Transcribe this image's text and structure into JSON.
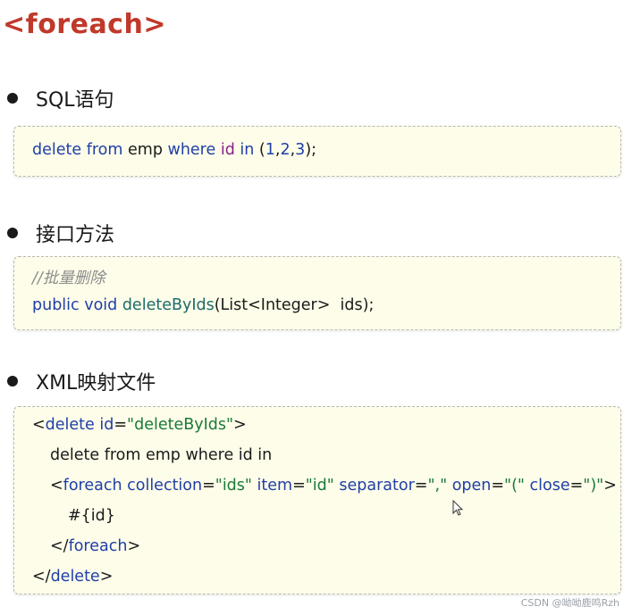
{
  "title": "<foreach>",
  "sections": [
    {
      "label": "SQL语句"
    },
    {
      "label": "接口方法"
    },
    {
      "label": "XML映射文件"
    }
  ],
  "sql": {
    "t1": "delete",
    "t2": " from",
    "t3": " emp ",
    "t4": "where",
    "t5": " ",
    "t6": "id",
    "t7": " in ",
    "t8": "(",
    "t9": "1",
    "t10": ",",
    "t11": "2",
    "t12": ",",
    "t13": "3",
    "t14": ");"
  },
  "iface": {
    "comment": "//批量删除",
    "t1": "public void ",
    "t2": "deleteByIds",
    "t3": "(List<Integer>  ids);"
  },
  "xml": {
    "l1a": "<",
    "l1b": "delete",
    "l1c": " id",
    "l1d": "=",
    "l1e": "\"deleteByIds\"",
    "l1f": ">",
    "l2": "delete from emp where id in",
    "l3a": "<",
    "l3b": "foreach",
    "l3c": " collection",
    "l3d": "=",
    "l3e": "\"ids\"",
    "l3f": " item",
    "l3g": "=",
    "l3h": "\"id\"",
    "l3i": " separator",
    "l3j": "=",
    "l3k": "\",\"",
    "l3l": " open",
    "l3m": "=",
    "l3n": "\"(\"",
    "l3o": " close",
    "l3p": "=",
    "l3q": "\")\"",
    "l3r": ">",
    "l4": "#{id}",
    "l5a": "</",
    "l5b": "foreach",
    "l5c": ">",
    "l6a": "</",
    "l6b": "delete",
    "l6c": ">"
  },
  "watermark": "CSDN @呦呦鹿鸣Rzh"
}
